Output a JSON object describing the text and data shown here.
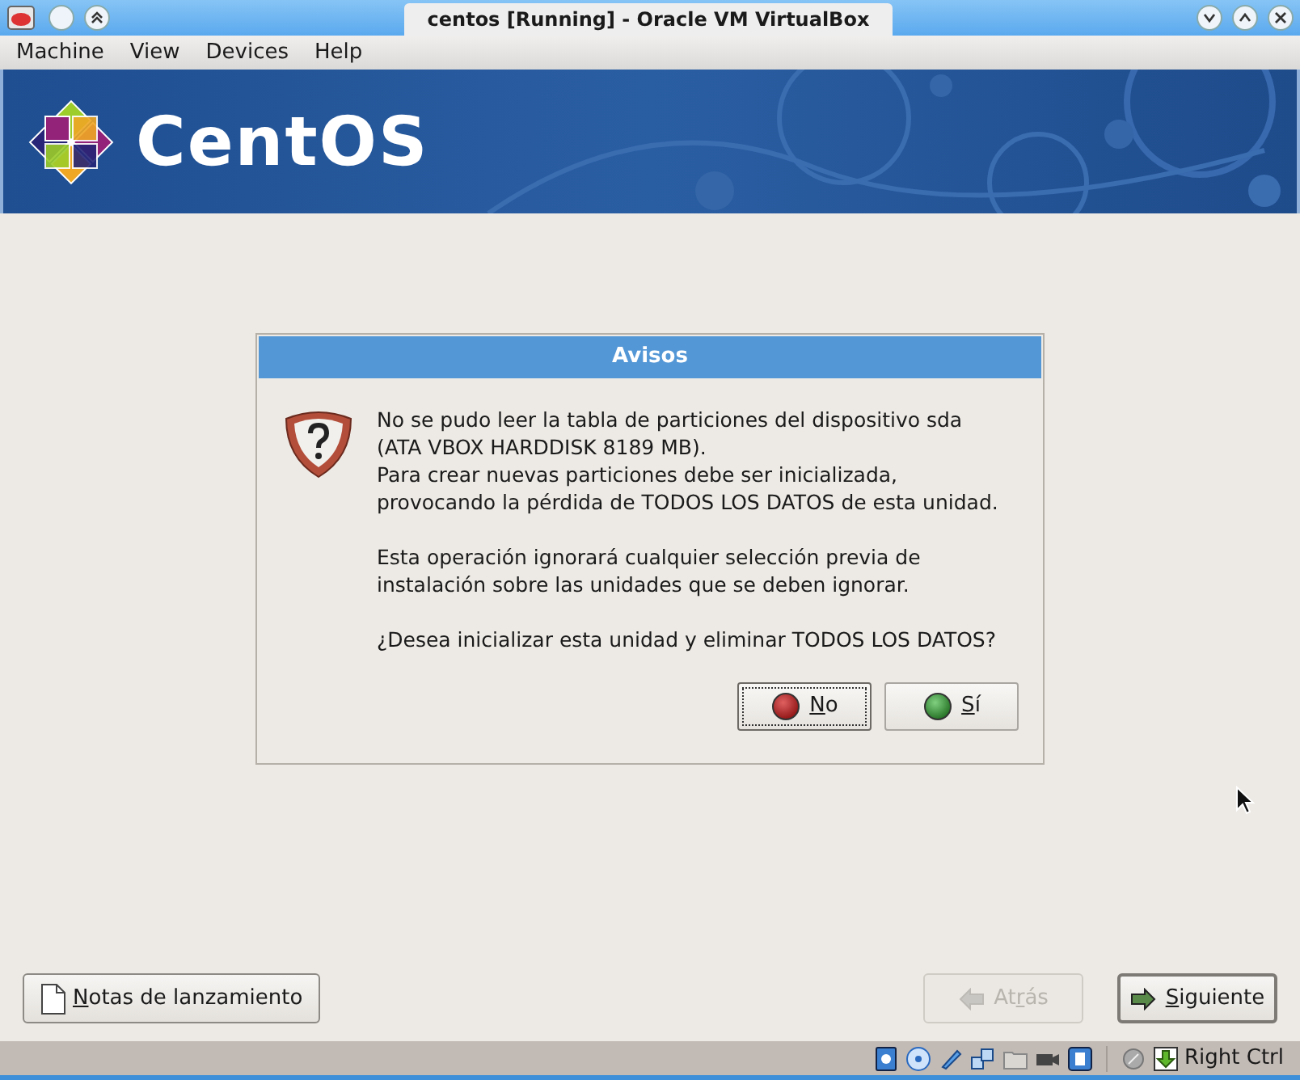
{
  "window": {
    "title": "centos [Running] - Oracle VM VirtualBox"
  },
  "menu": [
    "Machine",
    "View",
    "Devices",
    "Help"
  ],
  "banner": {
    "logo_text": "CentOS"
  },
  "dialog": {
    "title": "Avisos",
    "paragraphs": [
      [
        "No se pudo leer la tabla de particiones del dispositivo sda",
        "(ATA VBOX HARDDISK 8189 MB).",
        "Para crear nuevas particiones debe ser inicializada,",
        "provocando la pérdida de TODOS LOS DATOS de esta unidad."
      ],
      [
        "Esta operación ignorará cualquier selección previa de",
        "instalación sobre las unidades que se deben ignorar."
      ],
      [
        "¿Desea inicializar esta unidad y eliminar TODOS LOS DATOS?"
      ]
    ],
    "buttons": [
      {
        "kind": "no",
        "key": "N",
        "after": "o",
        "focused": true
      },
      {
        "kind": "yes",
        "key": "S",
        "after": "í",
        "focused": false
      }
    ]
  },
  "footer": {
    "left": {
      "key": "N",
      "after": "otas de lanzamiento"
    },
    "right": [
      {
        "kind": "back",
        "before": "At",
        "key": "r",
        "after": "ás",
        "disabled": true
      },
      {
        "kind": "next",
        "key": "S",
        "after": "iguiente",
        "disabled": false
      }
    ]
  },
  "status_bar": {
    "host_key": "Right Ctrl"
  }
}
